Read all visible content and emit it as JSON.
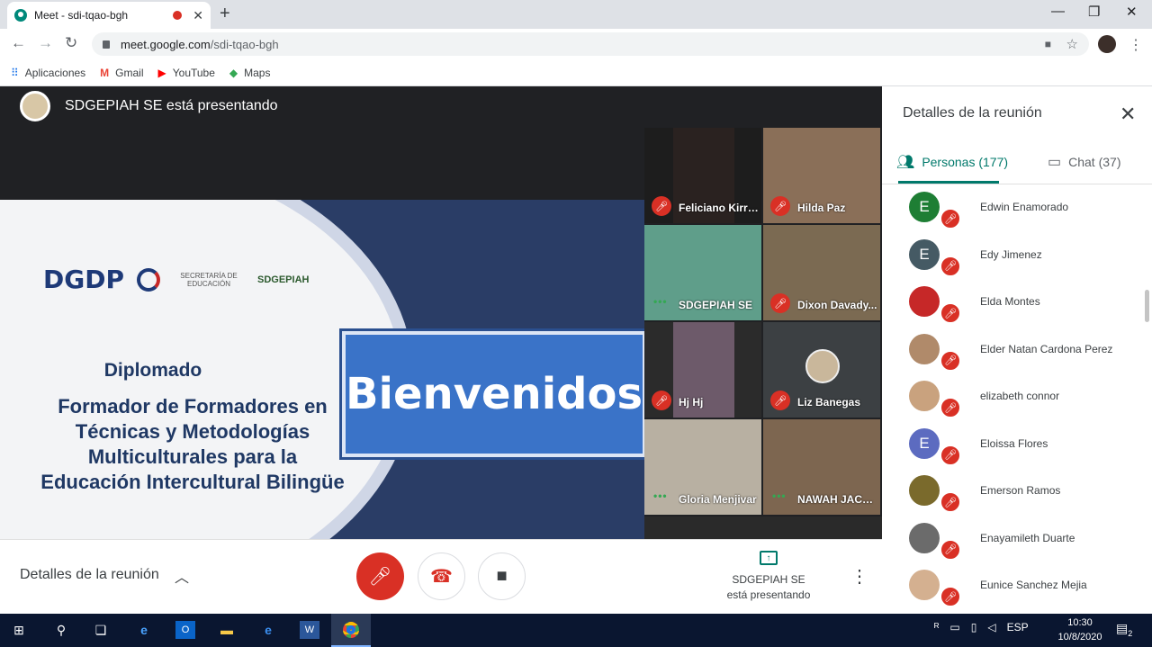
{
  "browser": {
    "tab_title": "Meet - sdi-tqao-bgh",
    "url_domain": "meet.google.com",
    "url_path": "/sdi-tqao-bgh",
    "bookmarks": [
      {
        "label": "Aplicaciones",
        "icon": "apps-grid-icon"
      },
      {
        "label": "Gmail",
        "icon": "gmail-icon"
      },
      {
        "label": "YouTube",
        "icon": "youtube-icon"
      },
      {
        "label": "Maps",
        "icon": "maps-icon"
      }
    ]
  },
  "meet": {
    "presenting_banner": "SDGEPIAH SE está presentando",
    "slide": {
      "logo_dgdp": "DGDP",
      "logo_secretaria": "SECRETARÍA DE EDUCACIÓN",
      "logo_sdgepiah": "SDGEPIAH",
      "title": "Diplomado",
      "subtitle": "Formador de Formadores en Técnicas y Metodologías Multiculturales para la Educación Intercultural Bilingüe",
      "welcome": "Bienvenidos"
    },
    "tiles": [
      {
        "name": "Feliciano Kirri...",
        "muted": true
      },
      {
        "name": "Hilda Paz",
        "muted": true
      },
      {
        "name": "SDGEPIAH SE",
        "muted": false
      },
      {
        "name": "Dixon Davady...",
        "muted": true
      },
      {
        "name": "Hj Hj",
        "muted": true
      },
      {
        "name": "Liz Banegas",
        "muted": true
      },
      {
        "name": "Gloria Menjivar",
        "muted": false
      },
      {
        "name": "NAWAH JACK...",
        "muted": false
      }
    ],
    "bottom": {
      "details_label": "Detalles de la reunión",
      "presenting_label_1": "SDGEPIAH SE",
      "presenting_label_2": "está presentando"
    },
    "panel": {
      "title": "Detalles de la reunión",
      "people_tab": "Personas (177)",
      "chat_tab": "Chat (37)",
      "people": [
        {
          "name": "Edwin Enamorado",
          "initial": "E",
          "color": "#1e7e34"
        },
        {
          "name": "Edy Jimenez",
          "initial": "E",
          "color": "#455a64"
        },
        {
          "name": "Elda Montes",
          "initial": "",
          "color": "#c62828"
        },
        {
          "name": "Elder Natan Cardona Perez",
          "initial": "",
          "color": "#b08a6a"
        },
        {
          "name": "elizabeth connor",
          "initial": "",
          "color": "#c9a27e"
        },
        {
          "name": "Eloissa Flores",
          "initial": "E",
          "color": "#5c6bc0"
        },
        {
          "name": "Emerson Ramos",
          "initial": "",
          "color": "#7a6a2c"
        },
        {
          "name": "Enayamileth Duarte",
          "initial": "",
          "color": "#6b6b6b"
        },
        {
          "name": "Eunice Sanchez Mejia",
          "initial": "",
          "color": "#d4b090"
        }
      ]
    }
  },
  "taskbar": {
    "language": "ESP",
    "time": "10:30",
    "date": "10/8/2020",
    "notifications": "2"
  }
}
